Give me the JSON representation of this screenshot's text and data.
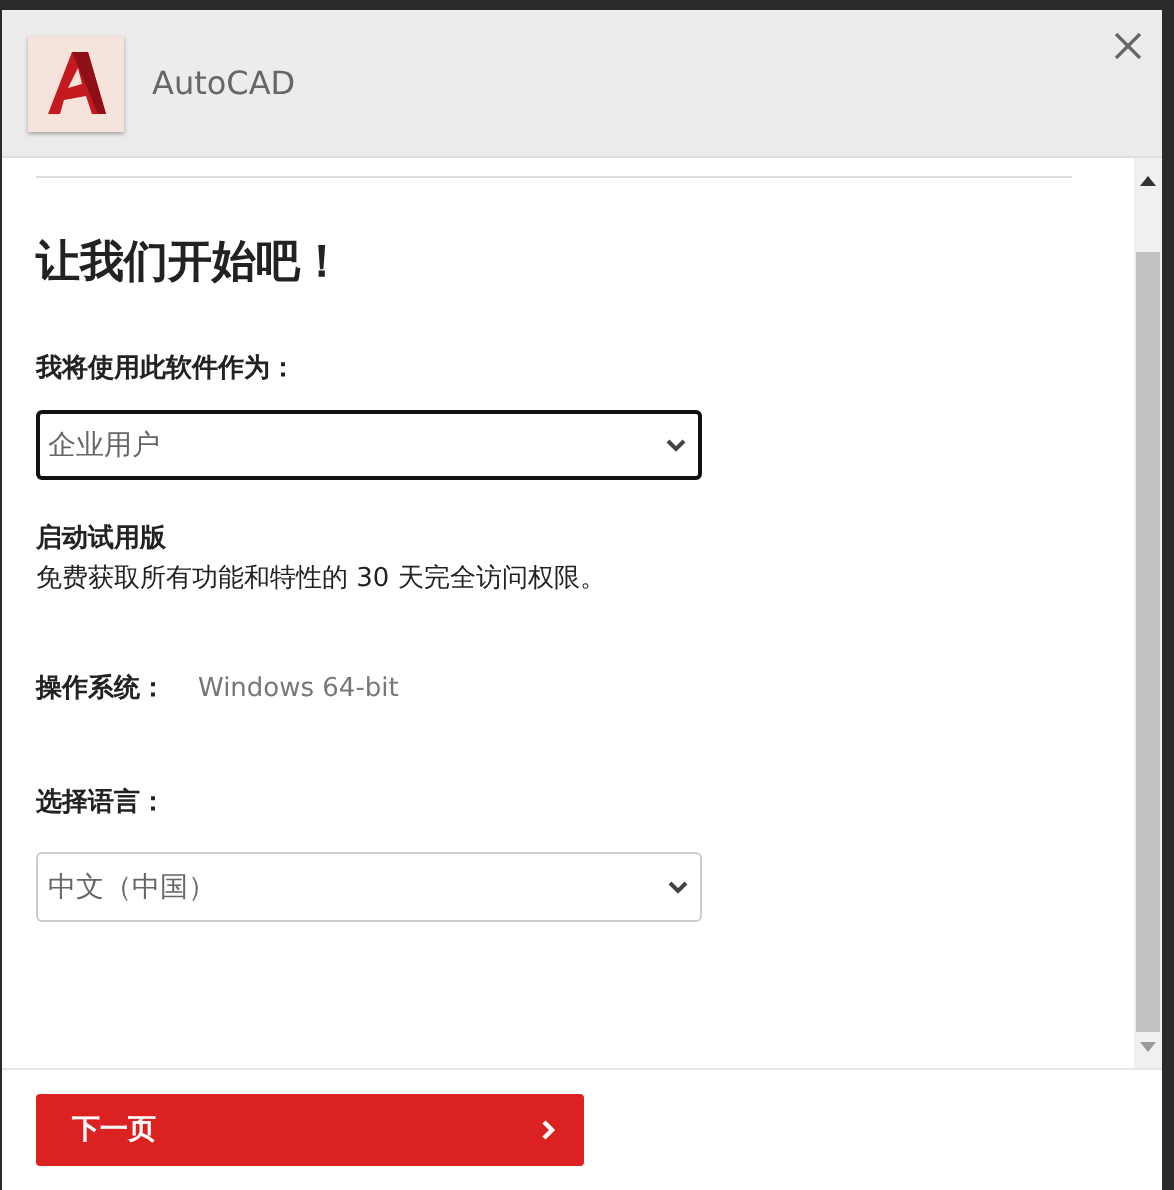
{
  "window": {
    "title": "AutoCAD"
  },
  "heading": "让我们开始吧！",
  "usage": {
    "label": "我将使用此软件作为：",
    "value": "企业用户",
    "focused": true
  },
  "trial": {
    "title": "启动试用版",
    "description": "免费获取所有功能和特性的 30 天完全访问权限。"
  },
  "os": {
    "label": "操作系统：",
    "value": "Windows 64-bit"
  },
  "language": {
    "label": "选择语言：",
    "value": "中文（中国）",
    "focused": false
  },
  "buttons": [
    {
      "label": "下一页"
    }
  ]
}
